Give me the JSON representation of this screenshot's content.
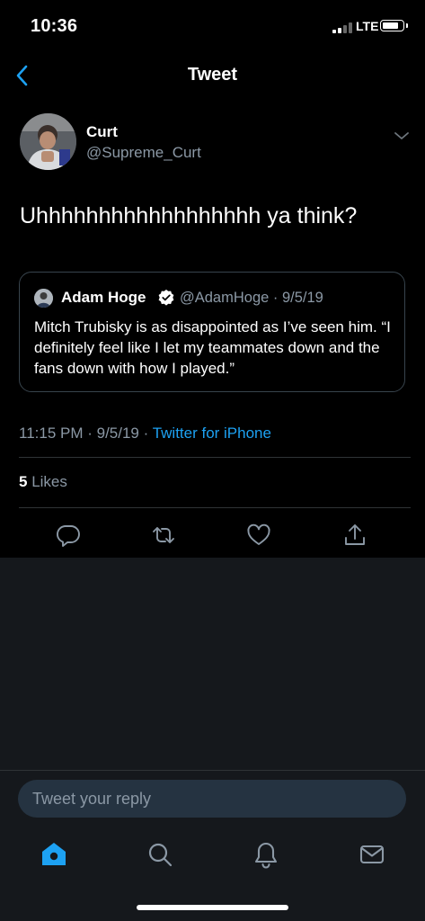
{
  "status_bar": {
    "time": "10:36",
    "network": "LTE"
  },
  "header": {
    "title": "Tweet"
  },
  "tweet": {
    "author_name": "Curt",
    "author_handle": "@Supreme_Curt",
    "text": "Uhhhhhhhhhhhhhhhhhh ya think?",
    "timestamp": "11:15 PM · 9/5/19 · ",
    "source": "Twitter for iPhone",
    "likes_count": "5",
    "likes_label": " Likes"
  },
  "quoted_tweet": {
    "author_name": "Adam Hoge",
    "author_handle": "@AdamHoge · 9/5/19",
    "text": "Mitch Trubisky is as disappointed as I’ve seen him. “I definitely feel like I let my teammates down and the fans down with how I played.”"
  },
  "reply": {
    "placeholder": "Tweet your reply"
  },
  "colors": {
    "accent": "#1da1f2",
    "secondary_text": "#8b98a5",
    "background": "#000000",
    "panel": "#15181c"
  },
  "icons": {
    "actions": [
      "reply-icon",
      "retweet-icon",
      "like-icon",
      "share-icon"
    ],
    "tabs": [
      "home-icon",
      "search-icon",
      "notifications-icon",
      "messages-icon"
    ]
  }
}
